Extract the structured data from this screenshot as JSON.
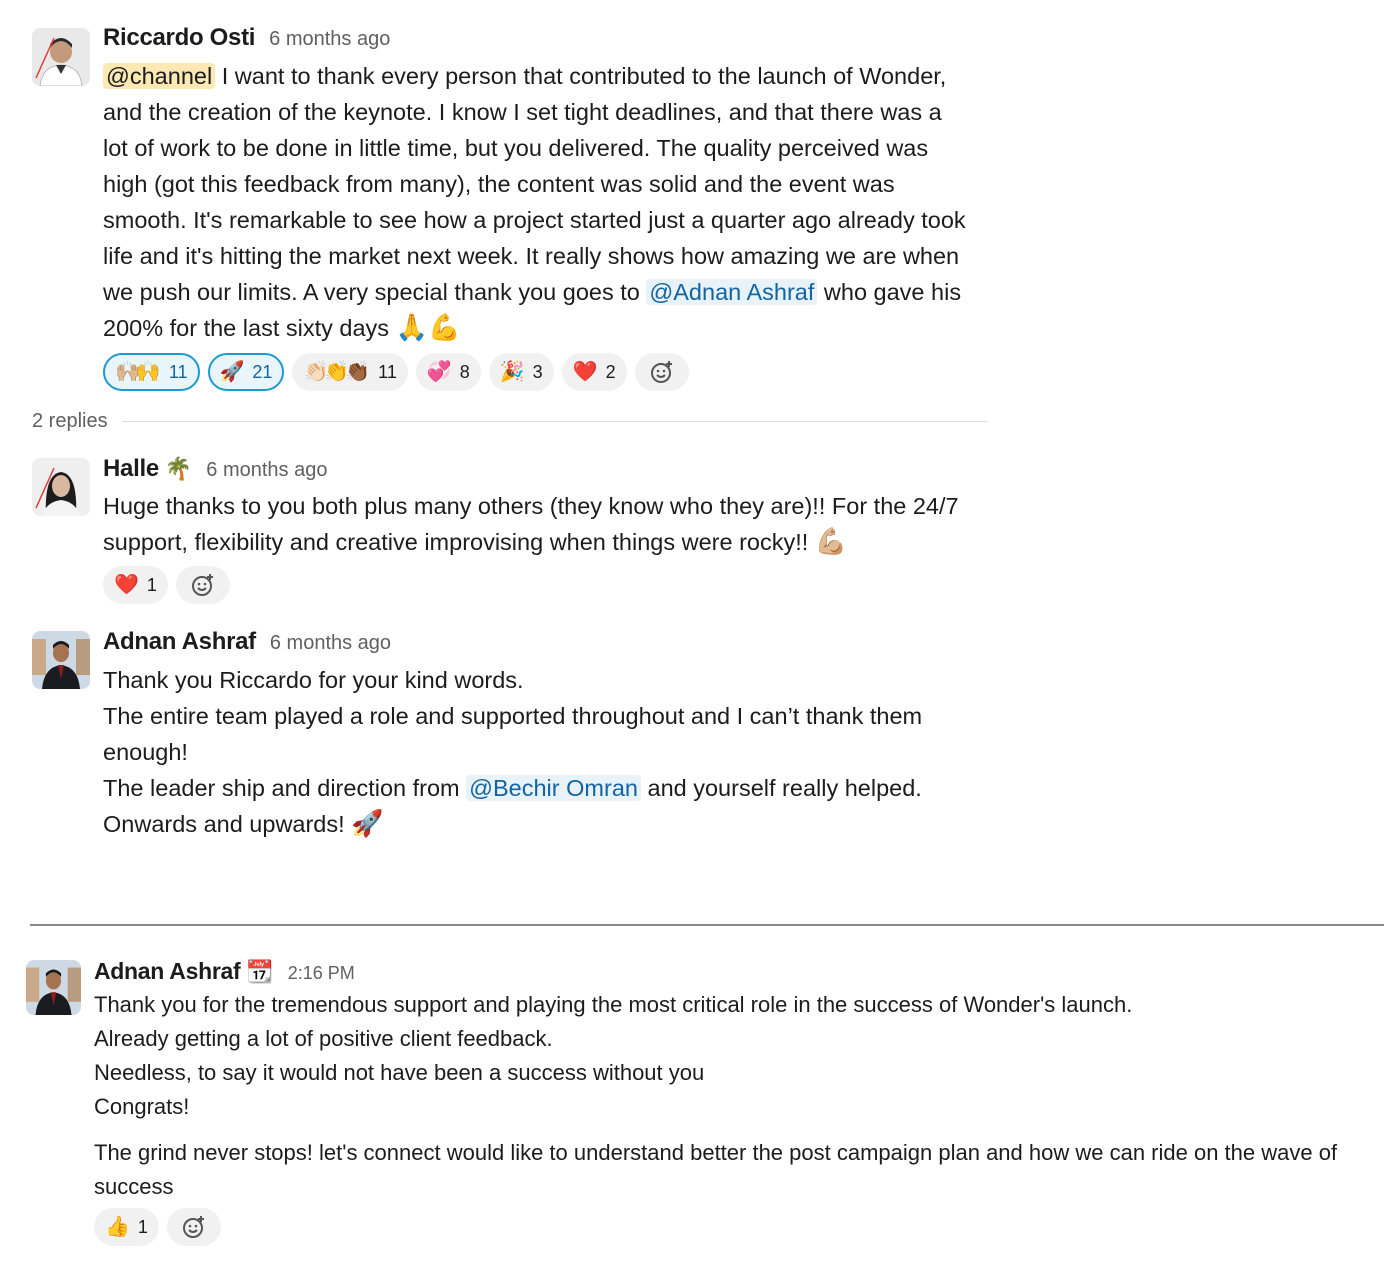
{
  "thread": {
    "parent": {
      "author": "Riccardo Osti",
      "time": "6 months ago",
      "mention_channel": "@channel",
      "lines": [
        " I want to thank every person that contributed to the launch of Wonder,",
        "and the creation of the keynote. I know I set tight deadlines, and that there was a",
        "lot of work to be done in little time, but you delivered. The quality perceived was",
        "high (got this feedback from many), the content was solid and the event was",
        "smooth. It's remarkable to see how a project started just a quarter ago already took",
        "life and it's hitting the market next week. It really shows how amazing we are when",
        "we push our limits. A very special thank you goes to "
      ],
      "mention_user": "@Adnan Ashraf",
      "line7_tail": " who gave his",
      "last_line": "200% for the last sixty days ",
      "last_emoji": "🙏💪",
      "reactions": [
        {
          "emoji": "🙌🏼🙌",
          "count": "11",
          "active": true
        },
        {
          "emoji": "🚀",
          "count": "21",
          "active": true
        },
        {
          "emoji": "👏🏻👏👏🏾",
          "count": "11",
          "active": false
        },
        {
          "emoji": "💞",
          "count": "8",
          "active": false
        },
        {
          "emoji": "🎉",
          "count": "3",
          "active": false
        },
        {
          "emoji": "❤️",
          "count": "2",
          "active": false
        }
      ]
    },
    "replies_label": "2 replies",
    "replies": [
      {
        "author": "Halle",
        "status_emoji": "🌴",
        "time": "6 months ago",
        "lines": [
          "Huge thanks to you both plus many others (they know who they are)!! For the 24/7",
          "support, flexibility and creative improvising when things were rocky!! "
        ],
        "trail_emoji": "💪🏼",
        "reactions": [
          {
            "emoji": "❤️",
            "count": "1"
          }
        ]
      },
      {
        "author": "Adnan Ashraf",
        "time": "6 months ago",
        "line1": "Thank you Riccardo for your kind words.",
        "line2": "The entire team played a role and supported throughout and I can’t thank them",
        "line3": "enough!",
        "line4_pre": "The leader ship and direction from ",
        "line4_mention": "@Bechir Omran",
        "line4_post": " and yourself really helped.",
        "line5": "Onwards and upwards! ",
        "line5_emoji": "🚀"
      }
    ]
  },
  "dm": {
    "author": "Adnan Ashraf",
    "status_emoji": "📆",
    "time": "2:16 PM",
    "lines": [
      "Thank you for the tremendous support and playing the most critical role in the success of Wonder's launch.",
      "Already getting a lot of positive client feedback.",
      "Needless, to say it would not have been a success without you",
      "Congrats!"
    ],
    "para2": [
      "The grind never stops! let's connect would like to understand better the post campaign plan and how we can ride on the wave of",
      "success"
    ],
    "reactions": [
      {
        "emoji": "👍",
        "count": "1"
      }
    ]
  },
  "icons": {
    "add_reaction": "add-reaction-icon"
  }
}
